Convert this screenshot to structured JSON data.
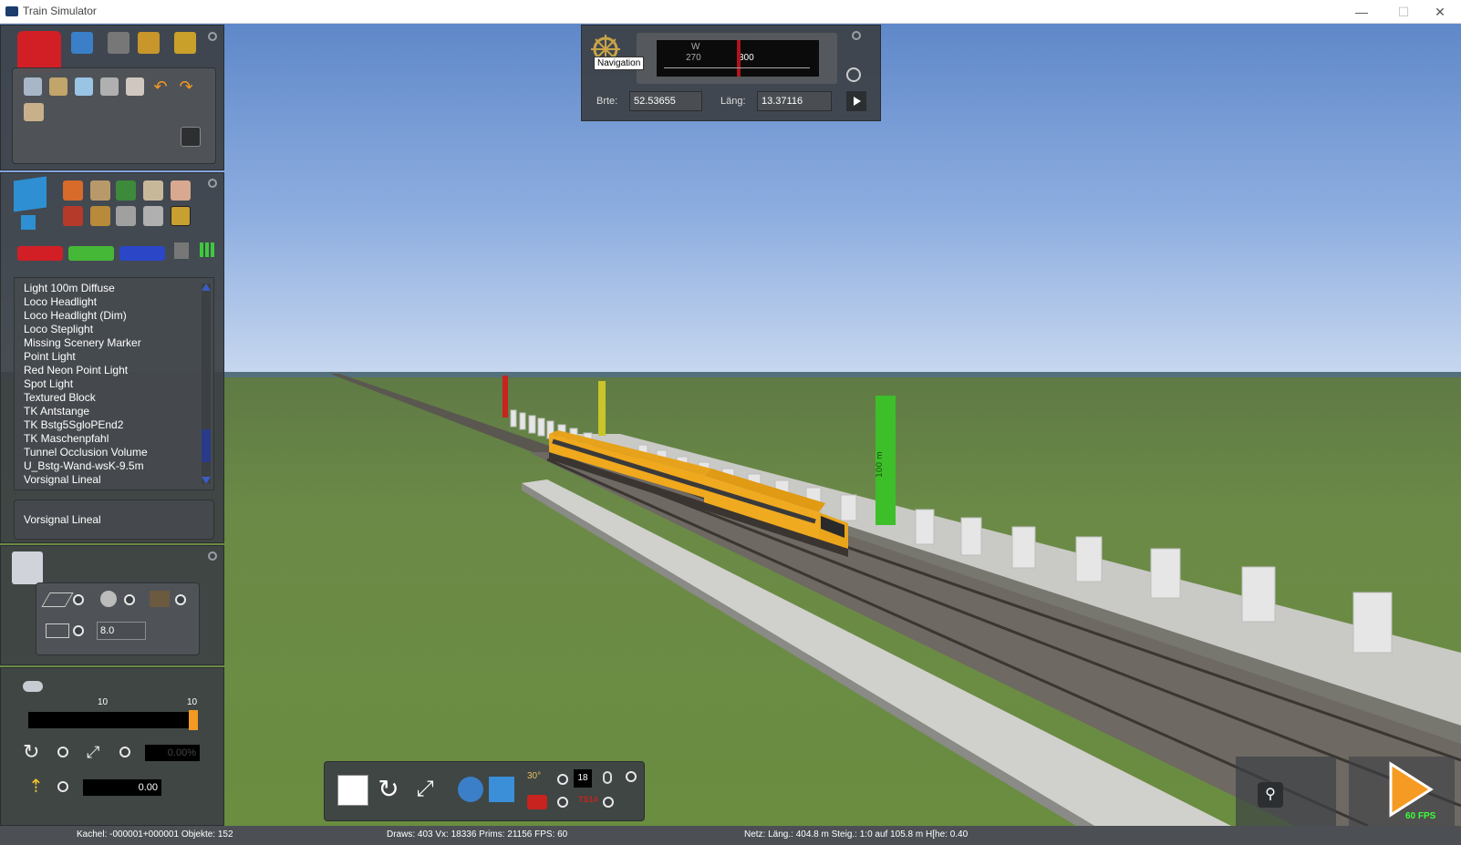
{
  "window": {
    "title": "Train Simulator",
    "minimize": "—",
    "maximize": "☐",
    "close": "✕"
  },
  "navigation": {
    "tooltip": "Navigation",
    "compass_w": "W",
    "compass_270": "270",
    "compass_300": "300",
    "lat_label": "Brte:",
    "lat_value": "52.53655",
    "lon_label": "Läng:",
    "lon_value": "13.37116"
  },
  "object_list": {
    "items": [
      "Light 100m Diffuse",
      "Loco Headlight",
      "Loco Headlight (Dim)",
      "Loco Steplight",
      "Missing Scenery Marker",
      "Point Light",
      "Red Neon Point Light",
      "Spot Light",
      "Textured Block",
      "TK Antstange",
      "TK Bstg5SgloPEnd2",
      "TK Maschenpfahl",
      "Tunnel Occlusion Volume",
      "U_Bstg-Wand-wsK-9.5m",
      "Vorsignal Lineal"
    ],
    "selected": "Vorsignal Lineal"
  },
  "properties": {
    "width_value": "8.0"
  },
  "brush": {
    "label_left": "10",
    "label_right": "10",
    "percent_value": "0.00%",
    "height_value": "0.00",
    "slider_level": 1.0
  },
  "bottom_toolbar": {
    "counter": "18",
    "ts14": "TS14"
  },
  "fps_badge": "60 FPS",
  "markers": {
    "green_text": "100 m"
  },
  "statusbar": {
    "tile": "Kachel: -000001+000001  Objekte: 152",
    "stats": "Draws: 403 Vx: 18336 Prims: 21156 FPS: 60",
    "net": "Netz:  Läng.: 404.8 m Steig.: 1:0 auf 105.8 m H[he:  0.40"
  },
  "colors": {
    "accent_orange": "#f59a22",
    "panel": "#3c4044",
    "train_yellow": "#f0a81c"
  }
}
